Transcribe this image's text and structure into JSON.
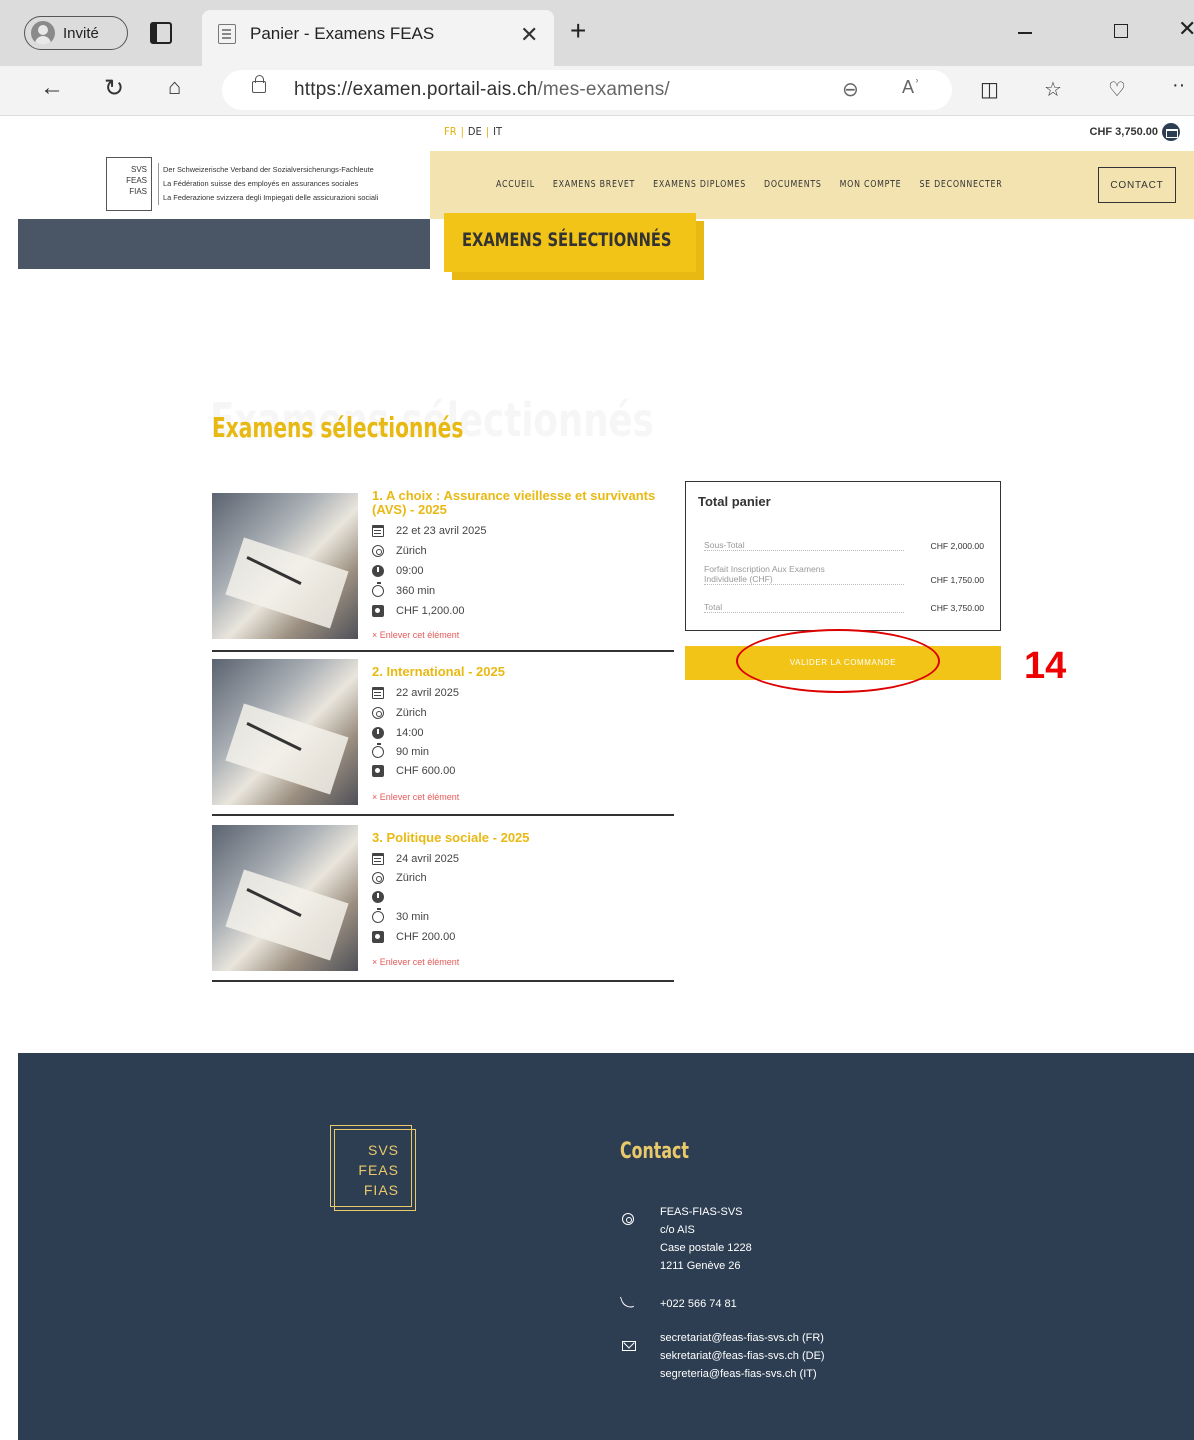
{
  "browser": {
    "profile_label": "Invité",
    "tab_title": "Panier - Examens FEAS",
    "url_host": "https://examen.portail-ais.ch",
    "url_path": "/mes-examens/"
  },
  "header": {
    "languages": [
      "FR",
      "DE",
      "IT"
    ],
    "cart_total": "CHF 3,750.00",
    "logo_mark": [
      "SVS",
      "FEAS",
      "FIAS"
    ],
    "logo_lines": [
      "Der Schweizerische Verband der Sozialversicherungs-Fachleute",
      "La Fédération suisse des employés en assurances sociales",
      "La Federazione svizzera degli Impiegati delle assicurazioni sociali"
    ],
    "nav": [
      "ACCUEIL",
      "EXAMENS BREVET",
      "EXAMENS DIPLOMES",
      "DOCUMENTS",
      "MON COMPTE",
      "SE DECONNECTER"
    ],
    "contact_button": "CONTACT"
  },
  "page_title": "EXAMENS SÉLECTIONNÉS",
  "section": {
    "ghost_heading": "Examens sélectionnés",
    "heading": "Examens sélectionnés"
  },
  "items": [
    {
      "title": "1. A choix : Assurance vieillesse et survivants (AVS) - 2025",
      "date": "22 et 23 avril 2025",
      "location": "Zürich",
      "time": "09:00",
      "duration": "360 min",
      "price": "CHF 1,200.00",
      "remove": "× Enlever cet élément"
    },
    {
      "title": "2. International - 2025",
      "date": "22 avril 2025",
      "location": "Zürich",
      "time": "14:00",
      "duration": "90 min",
      "price": "CHF 600.00",
      "remove": "× Enlever cet élément"
    },
    {
      "title": "3. Politique sociale - 2025",
      "date": "24 avril 2025",
      "location": "Zürich",
      "time": "",
      "duration": "30 min",
      "price": "CHF 200.00",
      "remove": "× Enlever cet élément"
    }
  ],
  "cart": {
    "title": "Total panier",
    "subtotal_label": "Sous-Total",
    "subtotal_value": "CHF 2,000.00",
    "fee_label_1": "Forfait Inscription Aux Examens",
    "fee_label_2": "Individuelle (CHF)",
    "fee_value": "CHF 1,750.00",
    "total_label": "Total",
    "total_value": "CHF 3,750.00",
    "validate_button": "VALIDER LA COMMANDE"
  },
  "annotation": {
    "number": "14",
    "color": "#e00000"
  },
  "footer": {
    "logo_mark": [
      "SVS",
      "FEAS",
      "FIAS"
    ],
    "contact_title": "Contact",
    "address": [
      "FEAS-FIAS-SVS",
      "c/o AIS",
      "Case postale 1228",
      "1211 Genève 26"
    ],
    "phone": "+022 566 74 81",
    "emails": [
      "secretariat@feas-fias-svs.ch (FR)",
      "sekretariat@feas-fias-svs.ch (DE)",
      "segreteria@feas-fias-svs.ch (IT)"
    ]
  },
  "colors": {
    "accent_yellow": "#f2c417",
    "nav_bg": "#f2e3b0",
    "footer_bg": "#2e3e52",
    "hero_bar": "#4a5565",
    "remove_link": "#e35a5a"
  }
}
